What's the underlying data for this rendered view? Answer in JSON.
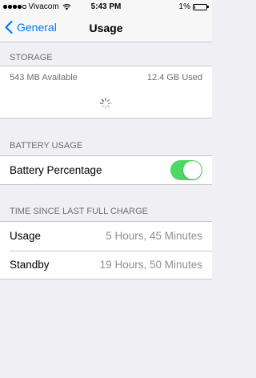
{
  "status_bar": {
    "carrier": "Vivacom",
    "time": "5:43 PM",
    "battery": "1%",
    "signal_bars": 4
  },
  "nav": {
    "back_label": "General",
    "title": "Usage",
    "accent_color": "#007aff"
  },
  "storage": {
    "header": "STORAGE",
    "available": "543 MB Available",
    "used": "12.4 GB Used"
  },
  "battery_usage": {
    "header": "BATTERY USAGE",
    "battery_percentage_label": "Battery Percentage",
    "battery_percentage_on": true,
    "toggle_color": "#4cd964"
  },
  "time_since_charge": {
    "header": "TIME SINCE LAST FULL CHARGE",
    "rows": [
      {
        "label": "Usage",
        "value": "5 Hours, 45 Minutes"
      },
      {
        "label": "Standby",
        "value": "19 Hours, 50 Minutes"
      }
    ]
  }
}
